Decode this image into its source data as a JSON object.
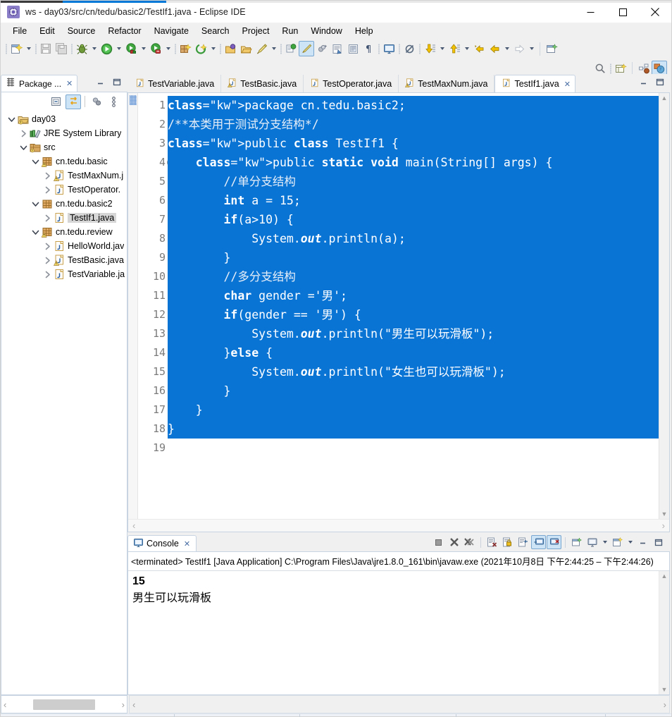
{
  "window": {
    "title": "ws - day03/src/cn/tedu/basic2/TestIf1.java - Eclipse IDE",
    "app_icon": "eclipse-icon",
    "minimize": "minimize-icon",
    "maximize": "maximize-icon",
    "close": "close-icon"
  },
  "menubar": {
    "items": [
      "File",
      "Edit",
      "Source",
      "Refactor",
      "Navigate",
      "Search",
      "Project",
      "Run",
      "Window",
      "Help"
    ]
  },
  "toolbar": {
    "icons": [
      "new-wizard-icon",
      "save-icon",
      "save-all-icon",
      "debug-icon",
      "run-icon",
      "run-last-tool-icon",
      "external-tools-icon",
      "new-java-package-icon",
      "open-type-icon",
      "open-task-icon",
      "search-icon",
      "toggle-mark-occurrences-icon",
      "skip-all-breakpoints-icon",
      "next-annotation-icon",
      "previous-annotation-icon",
      "back-icon",
      "forward-icon",
      "new-editor-icon"
    ]
  },
  "toolbar2": {
    "quick_access_icon": "search-icon",
    "open-perspective": "open-perspective-icon",
    "perspective_java_browsing": "java-browsing-perspective-icon",
    "perspective_java": "java-perspective-icon"
  },
  "package_explorer": {
    "tab_label": "Package ...",
    "tab_icon": "package-explorer-icon",
    "close_icon": "close-icon",
    "minimize_icon": "minimize-view-icon",
    "maximize_icon": "maximize-view-icon",
    "toolbar": [
      {
        "name": "collapse-all-icon",
        "active": false
      },
      {
        "name": "link-with-editor-icon",
        "active": true
      },
      {
        "name": "focus-on-active-task-icon",
        "active": false
      },
      {
        "name": "view-menu-icon",
        "active": false
      }
    ],
    "tree": [
      {
        "label": "day03",
        "depth": 0,
        "twisty": "expanded",
        "icon": "java-project-icon",
        "selected": false
      },
      {
        "label": "JRE System Library",
        "depth": 1,
        "twisty": "collapsed",
        "icon": "library-icon",
        "selected": false
      },
      {
        "label": "src",
        "depth": 1,
        "twisty": "expanded",
        "icon": "source-folder-icon",
        "selected": false
      },
      {
        "label": "cn.tedu.basic",
        "depth": 2,
        "twisty": "expanded",
        "icon": "package-warning-icon",
        "selected": false
      },
      {
        "label": "TestMaxNum.j",
        "depth": 3,
        "twisty": "collapsed",
        "icon": "java-file-warning-icon",
        "selected": false
      },
      {
        "label": "TestOperator.",
        "depth": 3,
        "twisty": "collapsed",
        "icon": "java-file-icon",
        "selected": false
      },
      {
        "label": "cn.tedu.basic2",
        "depth": 2,
        "twisty": "expanded",
        "icon": "package-icon",
        "selected": false
      },
      {
        "label": "TestIf1.java",
        "depth": 3,
        "twisty": "collapsed",
        "icon": "java-file-icon",
        "selected": true
      },
      {
        "label": "cn.tedu.review",
        "depth": 2,
        "twisty": "expanded",
        "icon": "package-warning-icon",
        "selected": false
      },
      {
        "label": "HelloWorld.jav",
        "depth": 3,
        "twisty": "collapsed",
        "icon": "java-file-icon",
        "selected": false
      },
      {
        "label": "TestBasic.java",
        "depth": 3,
        "twisty": "collapsed",
        "icon": "java-file-warning-icon",
        "selected": false
      },
      {
        "label": "TestVariable.ja",
        "depth": 3,
        "twisty": "collapsed",
        "icon": "java-file-icon",
        "selected": false
      }
    ]
  },
  "editor": {
    "tabs": [
      {
        "label": "TestVariable.java",
        "icon": "java-file-icon",
        "active": false
      },
      {
        "label": "TestBasic.java",
        "icon": "java-file-warning-icon",
        "active": false
      },
      {
        "label": "TestOperator.java",
        "icon": "java-file-icon",
        "active": false
      },
      {
        "label": "TestMaxNum.java",
        "icon": "java-file-warning-icon",
        "active": false
      },
      {
        "label": "TestIf1.java",
        "icon": "java-file-icon",
        "active": true
      }
    ],
    "close_icon": "close-icon",
    "minimize_icon": "minimize-view-icon",
    "maximize_icon": "maximize-view-icon",
    "line_numbers": [
      "1",
      "2",
      "3",
      "4",
      "5",
      "6",
      "7",
      "8",
      "9",
      "10",
      "11",
      "12",
      "13",
      "14",
      "15",
      "16",
      "17",
      "18",
      "19"
    ],
    "fold_line": "4",
    "selection_color": "#0a74d5",
    "code_lines": [
      "package cn.tedu.basic2;",
      "/**本类用于测试分支结构*/",
      "public class TestIf1 {",
      "    public static void main(String[] args) {",
      "        //单分支结构",
      "        int a = 15;",
      "        if(a>10) {",
      "            System.out.println(a);",
      "        }",
      "        //多分支结构",
      "        char gender ='男';",
      "        if(gender == '男') {",
      "            System.out.println(\"男生可以玩滑板\");",
      "        }else {",
      "            System.out.println(\"女生也可以玩滑板\");",
      "        }",
      "    }",
      "}",
      ""
    ]
  },
  "console": {
    "tab_label": "Console",
    "tab_icon": "console-icon",
    "close_icon": "close-icon",
    "toolbar": [
      {
        "name": "terminate-icon",
        "active": false
      },
      {
        "name": "remove-launch-icon",
        "active": false
      },
      {
        "name": "remove-all-terminated-icon",
        "active": false
      },
      {
        "name": "clear-console-icon",
        "active": false
      },
      {
        "name": "scroll-lock-icon",
        "active": false
      },
      {
        "name": "word-wrap-icon",
        "active": false
      },
      {
        "name": "show-console-on-output-icon",
        "active": true
      },
      {
        "name": "show-console-on-error-icon",
        "active": true
      },
      {
        "name": "pin-console-icon",
        "active": false
      },
      {
        "name": "display-selected-console-icon",
        "active": false
      },
      {
        "name": "open-console-icon",
        "active": false
      },
      {
        "name": "minimize-view-icon",
        "active": false
      },
      {
        "name": "maximize-view-icon",
        "active": false
      }
    ],
    "status_line": "<terminated> TestIf1 [Java Application] C:\\Program Files\\Java\\jre1.8.0_161\\bin\\javaw.exe  (2021年10月8日 下午2:44:25 – 下午2:44:26)",
    "output_lines": [
      "15",
      "男生可以玩滑板"
    ]
  },
  "scrollbars": {
    "left_arrow": "‹",
    "right_arrow": "›",
    "up_arrow": "▲",
    "down_arrow": "▼"
  }
}
